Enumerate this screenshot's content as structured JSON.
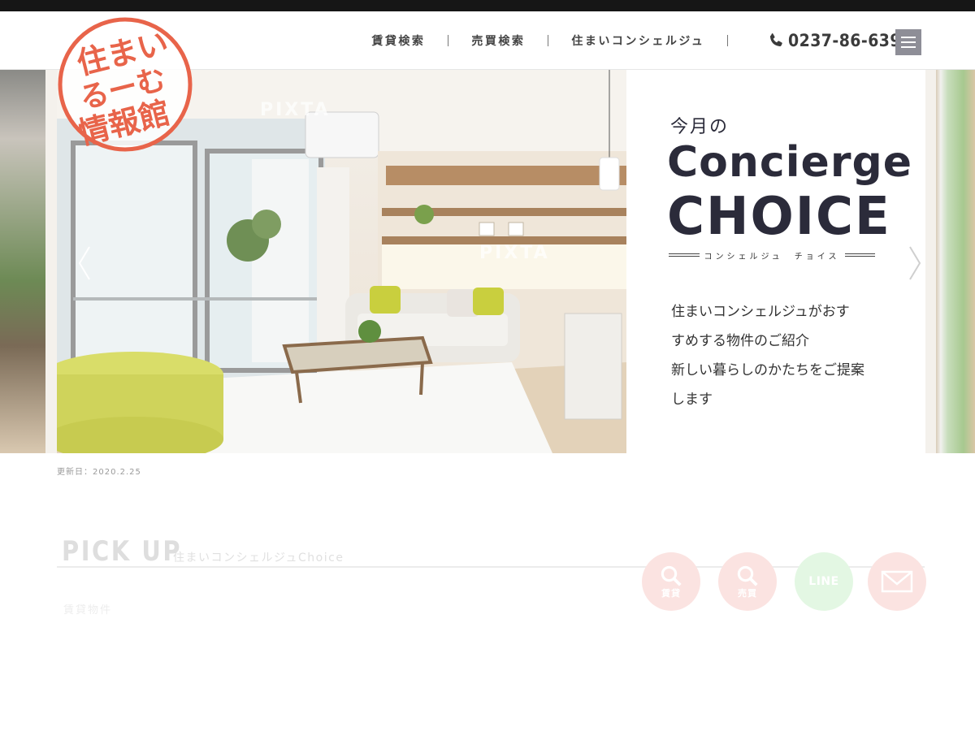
{
  "logo": {
    "line1": "住まい",
    "line2": "るーむ",
    "line3": "情報館",
    "color": "#e8644a"
  },
  "nav": {
    "items": [
      {
        "label": "賃貸検索"
      },
      {
        "label": "売買検索"
      },
      {
        "label": "住まいコンシェルジュ"
      }
    ],
    "phone": "0237-86-6396",
    "menu_icon": "hamburger-icon"
  },
  "slider": {
    "watermark": "PIXTA",
    "panel": {
      "subtitle": "今月の",
      "title_line1": "Concierge",
      "title_line2": "CHOICE",
      "rule_text": "コンシェルジュ　チョイス",
      "description": [
        "住まいコンシェルジュがおす",
        "すめする物件のご紹介",
        "新しい暮らしのかたちをご提案",
        "します"
      ]
    },
    "prev_icon": "chevron-left-icon",
    "next_icon": "chevron-right-icon"
  },
  "updated": "更新日：2020.2.25",
  "pickup": {
    "title": "PICK UP",
    "subtitle": "住まいコンシェルジュChoice",
    "subtext": "賃貸物件"
  },
  "fabs": {
    "rent_label": "賃貸",
    "buy_label": "売買",
    "line_label": "LINE",
    "mail_icon": "mail-icon",
    "accent_pink": "#fbe3e1",
    "accent_green": "#e3f7e3"
  }
}
